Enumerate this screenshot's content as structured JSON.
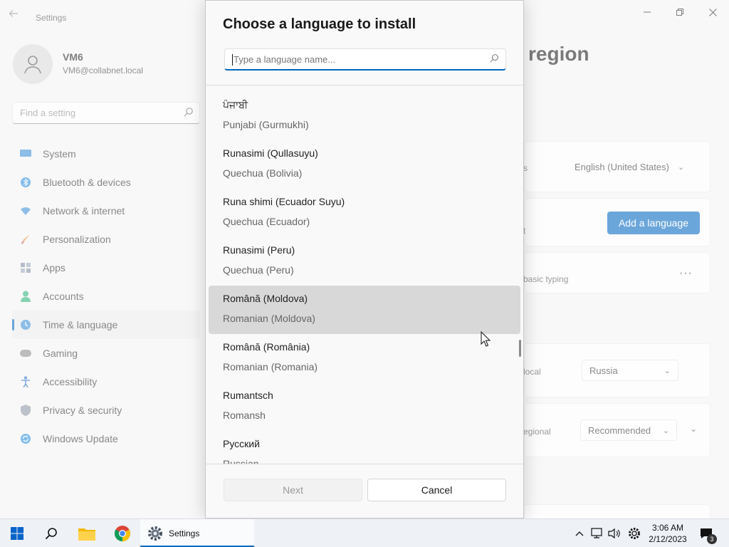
{
  "window": {
    "app_title": "Settings",
    "user": {
      "name": "VM6",
      "email": "VM6@collabnet.local"
    },
    "search_placeholder": "Find a setting",
    "nav": [
      {
        "label": "System",
        "icon": "monitor-icon"
      },
      {
        "label": "Bluetooth & devices",
        "icon": "bluetooth-icon"
      },
      {
        "label": "Network & internet",
        "icon": "wifi-icon"
      },
      {
        "label": "Personalization",
        "icon": "brush-icon"
      },
      {
        "label": "Apps",
        "icon": "apps-icon"
      },
      {
        "label": "Accounts",
        "icon": "person-icon"
      },
      {
        "label": "Time & language",
        "icon": "globe-clock-icon",
        "active": true
      },
      {
        "label": "Gaming",
        "icon": "gamepad-icon"
      },
      {
        "label": "Accessibility",
        "icon": "accessibility-icon"
      },
      {
        "label": "Privacy & security",
        "icon": "shield-icon"
      },
      {
        "label": "Windows Update",
        "icon": "update-icon"
      }
    ],
    "page_heading": "region",
    "display_language": {
      "label_fragment": "s",
      "value": "English (United States)"
    },
    "preferred": {
      "label_fragment": "t",
      "add_button": "Add a language"
    },
    "lang_card": {
      "label_fragment": "basic typing",
      "more": "···"
    },
    "country": {
      "label_fragment": "local",
      "value": "Russia"
    },
    "regional_format": {
      "label_fragment": "egional",
      "value": "Recommended"
    }
  },
  "dialog": {
    "title": "Choose a language to install",
    "search_placeholder": "Type a language name...",
    "languages": [
      {
        "native": "ਪੰਜਾਬੀ",
        "english": "Punjabi (Gurmukhi)"
      },
      {
        "native": "Runasimi (Qullasuyu)",
        "english": "Quechua (Bolivia)"
      },
      {
        "native": "Runa shimi (Ecuador Suyu)",
        "english": "Quechua (Ecuador)"
      },
      {
        "native": "Runasimi (Peru)",
        "english": "Quechua (Peru)"
      },
      {
        "native": "Română (Moldova)",
        "english": "Romanian (Moldova)",
        "hovered": true
      },
      {
        "native": "Română (România)",
        "english": "Romanian (Romania)"
      },
      {
        "native": "Rumantsch",
        "english": "Romansh"
      },
      {
        "native": "Русский",
        "english": "Russian"
      }
    ],
    "next_label": "Next",
    "cancel_label": "Cancel"
  },
  "taskbar": {
    "settings_label": "Settings",
    "time": "3:06 AM",
    "date": "2/12/2023",
    "notification_count": "3"
  },
  "colors": {
    "accent": "#0067c0"
  }
}
